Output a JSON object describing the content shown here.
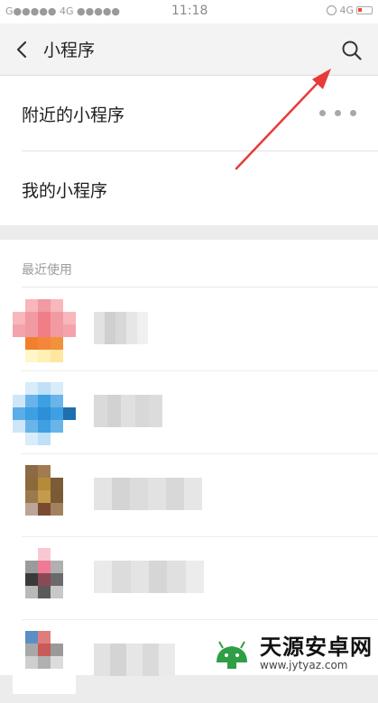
{
  "status_bar": {
    "signal_left": "G●●●●● 4G ●●●●●",
    "time": "11:18",
    "network_right": "4G"
  },
  "header": {
    "title": "小程序",
    "back_icon": "chevron-left-icon",
    "search_icon": "search-icon"
  },
  "menu": {
    "nearby_label": "附近的小程序",
    "mine_label": "我的小程序"
  },
  "recent": {
    "header": "最近使用",
    "items": [
      {
        "name": "[pixelated]",
        "icon_colors": [
          "#ffffff",
          "#f7b7bc",
          "#f29aa1",
          "#f7b7bc",
          "#ffffff",
          "#f7b7bc",
          "#f29aa1",
          "#f07e87",
          "#f29aa1",
          "#f7b7bc",
          "#f4a3aa",
          "#f29aa1",
          "#f07e87",
          "#f29aa1",
          "#f4a3aa",
          "#ffffff",
          "#f17f2d",
          "#f5853b",
          "#f0913d",
          "#ffffff",
          "#ffffff",
          "#fff6c9",
          "#fff0b3",
          "#ffe7a0",
          "#ffffff"
        ],
        "name_colors": [
          "#e2e2e2",
          "#cfcfcf",
          "#d8d8d8",
          "#e6e6e6",
          "#f0f0f0"
        ]
      },
      {
        "name": "[pixelated]",
        "icon_colors": [
          "#ffffff",
          "#d8ecfa",
          "#bfe0f7",
          "#d8ecfa",
          "#ffffff",
          "#cfe6f8",
          "#69b5ea",
          "#3e9fe3",
          "#69b5ea",
          "#ffffff",
          "#5aaee8",
          "#3e9fe3",
          "#2c8fd8",
          "#3e9fe3",
          "#1e6fb0",
          "#cfe6f8",
          "#69b5ea",
          "#3e9fe3",
          "#69b5ea",
          "#ffffff",
          "#ffffff",
          "#d8ecfa",
          "#bfe0f7",
          "#ffffff",
          "#ffffff"
        ],
        "name_colors": [
          "#dadada",
          "#d2d2d2",
          "#e0e0e0",
          "#d8d8d8",
          "#dcdcdc"
        ]
      },
      {
        "name": "[pixelated]",
        "icon_colors": [
          "#ffffff",
          "#8c6a46",
          "#a37b50",
          "#ffffff",
          "#ffffff",
          "#ffffff",
          "#8a6a3a",
          "#b78a3a",
          "#7a5c35",
          "#ffffff",
          "#ffffff",
          "#9a7a4c",
          "#c49a4d",
          "#7a5a34",
          "#ffffff",
          "#ffffff",
          "#bba596",
          "#7a4a30",
          "#a0825f",
          "#ffffff",
          "#ffffff",
          "#ffffff",
          "#ffffff",
          "#ffffff",
          "#ffffff"
        ],
        "name_colors": [
          "#e4e4e4",
          "#d4d4d4",
          "#dcdcdc",
          "#e2e2e2",
          "#d8d8d8",
          "#e6e6e6"
        ]
      },
      {
        "name": "[pixelated]",
        "icon_colors": [
          "#ffffff",
          "#ffffff",
          "#f9c8d2",
          "#ffffff",
          "#ffffff",
          "#ffffff",
          "#9b9b9b",
          "#ef7a95",
          "#b0b0b0",
          "#ffffff",
          "#ffffff",
          "#3a3a3a",
          "#8a4a55",
          "#6a6a6a",
          "#ffffff",
          "#ffffff",
          "#b9b9b9",
          "#5a5a5a",
          "#c8c8c8",
          "#ffffff",
          "#ffffff",
          "#ffffff",
          "#ffffff",
          "#ffffff",
          "#ffffff"
        ],
        "name_colors": [
          "#eaeaea",
          "#dcdcdc",
          "#e4e4e4",
          "#d6d6d6",
          "#e0e0e0",
          "#ececec"
        ]
      },
      {
        "name": "[pixelated]",
        "icon_colors": [
          "#ffffff",
          "#5b8fc4",
          "#e07c7c",
          "#ffffff",
          "#ffffff",
          "#ffffff",
          "#a8a8a8",
          "#c85a5a",
          "#9a9a9a",
          "#ffffff",
          "#ffffff",
          "#cfcfcf",
          "#b0b0b0",
          "#dcdcdc",
          "#ffffff",
          "#ffffff",
          "#ffffff",
          "#ffffff",
          "#ffffff",
          "#ffffff",
          "#ffffff",
          "#ffffff",
          "#ffffff",
          "#ffffff",
          "#ffffff"
        ],
        "name_colors": [
          "#e2e2e2",
          "#d4d4d4",
          "#e6e6e6",
          "#dadada",
          "#eaeaea"
        ]
      }
    ]
  },
  "annotation": {
    "arrow_color": "#e83a3a"
  },
  "watermark": {
    "text_cn": "天源安卓网",
    "url": "www.jytyaz.com"
  }
}
